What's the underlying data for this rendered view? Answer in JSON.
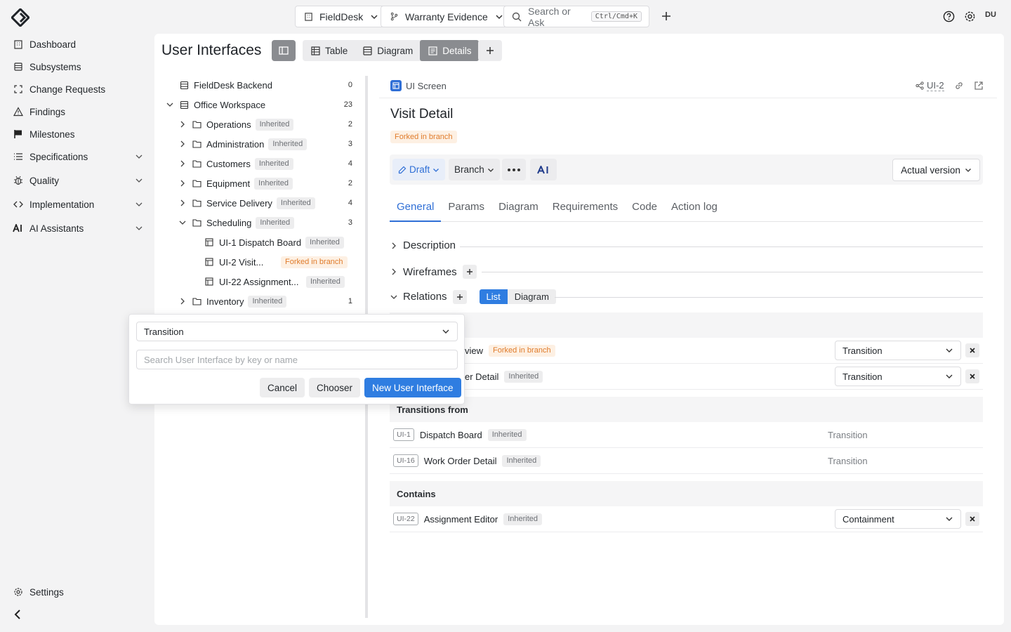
{
  "topbar": {
    "project": "FieldDesk",
    "branch": "Warranty Evidence",
    "search_placeholder": "Search or Ask",
    "search_shortcut": "Ctrl/Cmd+K",
    "avatar": "DU"
  },
  "sidebar": {
    "items": [
      {
        "label": "Dashboard",
        "icon": "building-icon"
      },
      {
        "label": "Subsystems",
        "icon": "database-icon"
      },
      {
        "label": "Change Requests",
        "icon": "frame-icon"
      },
      {
        "label": "Findings",
        "icon": "alert-triangle-icon"
      },
      {
        "label": "Milestones",
        "icon": "flag-icon"
      },
      {
        "label": "Specifications",
        "icon": "list-icon"
      },
      {
        "label": "Quality",
        "icon": "bug-icon"
      },
      {
        "label": "Implementation",
        "icon": "code-icon"
      },
      {
        "label": "AI Assistants",
        "icon": "ai-icon"
      }
    ],
    "settings": "Settings"
  },
  "main": {
    "title": "User Interfaces",
    "view_tabs": [
      "Table",
      "Diagram",
      "Details"
    ]
  },
  "tree": {
    "rows": [
      {
        "label": "FieldDesk Backend",
        "count": "0"
      },
      {
        "label": "Office Workspace",
        "count": "23"
      },
      {
        "label": "Operations",
        "badge": "Inherited",
        "count": "2"
      },
      {
        "label": "Administration",
        "badge": "Inherited",
        "count": "3"
      },
      {
        "label": "Customers",
        "badge": "Inherited",
        "count": "4"
      },
      {
        "label": "Equipment",
        "badge": "Inherited",
        "count": "2"
      },
      {
        "label": "Service Delivery",
        "badge": "Inherited",
        "count": "4"
      },
      {
        "label": "Scheduling",
        "badge": "Inherited",
        "count": "3"
      },
      {
        "label": "UI-1 Dispatch Board",
        "badge": "Inherited"
      },
      {
        "label": "UI-2 Visit...",
        "badge": "Forked in branch"
      },
      {
        "label": "UI-22 Assignment...",
        "badge": "Inherited"
      },
      {
        "label": "Inventory",
        "badge": "Inherited",
        "count": "1"
      }
    ]
  },
  "detail": {
    "type_label": "UI Screen",
    "key": "UI-2",
    "title": "Visit Detail",
    "status_badge": "Forked in branch",
    "toolbar": {
      "draft": "Draft",
      "branch": "Branch",
      "ai": "AI",
      "version": "Actual version"
    },
    "tabs": [
      "General",
      "Params",
      "Diagram",
      "Requirements",
      "Code",
      "Action log"
    ],
    "sections": {
      "description": "Description",
      "wireframes": "Wireframes",
      "relations": "Relations",
      "view_list": "List",
      "view_diagram": "Diagram"
    },
    "relations": {
      "to_rows": [
        {
          "name": "view",
          "badge": "Forked in branch",
          "type": "Transition"
        },
        {
          "name": "er Detail",
          "badge": "Inherited",
          "type": "Transition"
        }
      ],
      "from_header": "Transitions from",
      "from_rows": [
        {
          "key": "UI-1",
          "name": "Dispatch Board",
          "badge": "Inherited",
          "type": "Transition"
        },
        {
          "key": "UI-16",
          "name": "Work Order Detail",
          "badge": "Inherited",
          "type": "Transition"
        }
      ],
      "contains_header": "Contains",
      "contains_rows": [
        {
          "key": "UI-22",
          "name": "Assignment Editor",
          "badge": "Inherited",
          "type": "Containment"
        }
      ]
    }
  },
  "popup": {
    "relation_type": "Transition",
    "search_placeholder": "Search User Interface by key or name",
    "cancel": "Cancel",
    "chooser": "Chooser",
    "new": "New User Interface"
  },
  "colors": {
    "accent": "#2f7de1",
    "fork": "#e07b2a"
  }
}
